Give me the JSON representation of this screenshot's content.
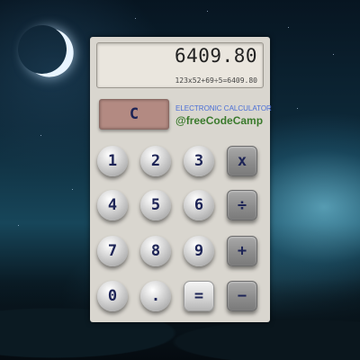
{
  "display": {
    "value": "6409.80",
    "expression": "123x52+69÷5=6409.80"
  },
  "brand": {
    "title": "ELECTRONIC CALCULATOR",
    "handle": "@freeCodeCamp"
  },
  "keys": {
    "clear": "C",
    "one": "1",
    "two": "2",
    "three": "3",
    "four": "4",
    "five": "5",
    "six": "6",
    "seven": "7",
    "eight": "8",
    "nine": "9",
    "zero": "0",
    "decimal": ".",
    "equals": "=",
    "multiply": "x",
    "divide": "÷",
    "add": "+",
    "subtract": "−"
  },
  "colors": {
    "body": "#d9d6cf",
    "clear_key": "#b38a82",
    "key_text": "#1d2456",
    "brand_title": "#4b6fd6",
    "brand_handle": "#3a7a2c"
  }
}
